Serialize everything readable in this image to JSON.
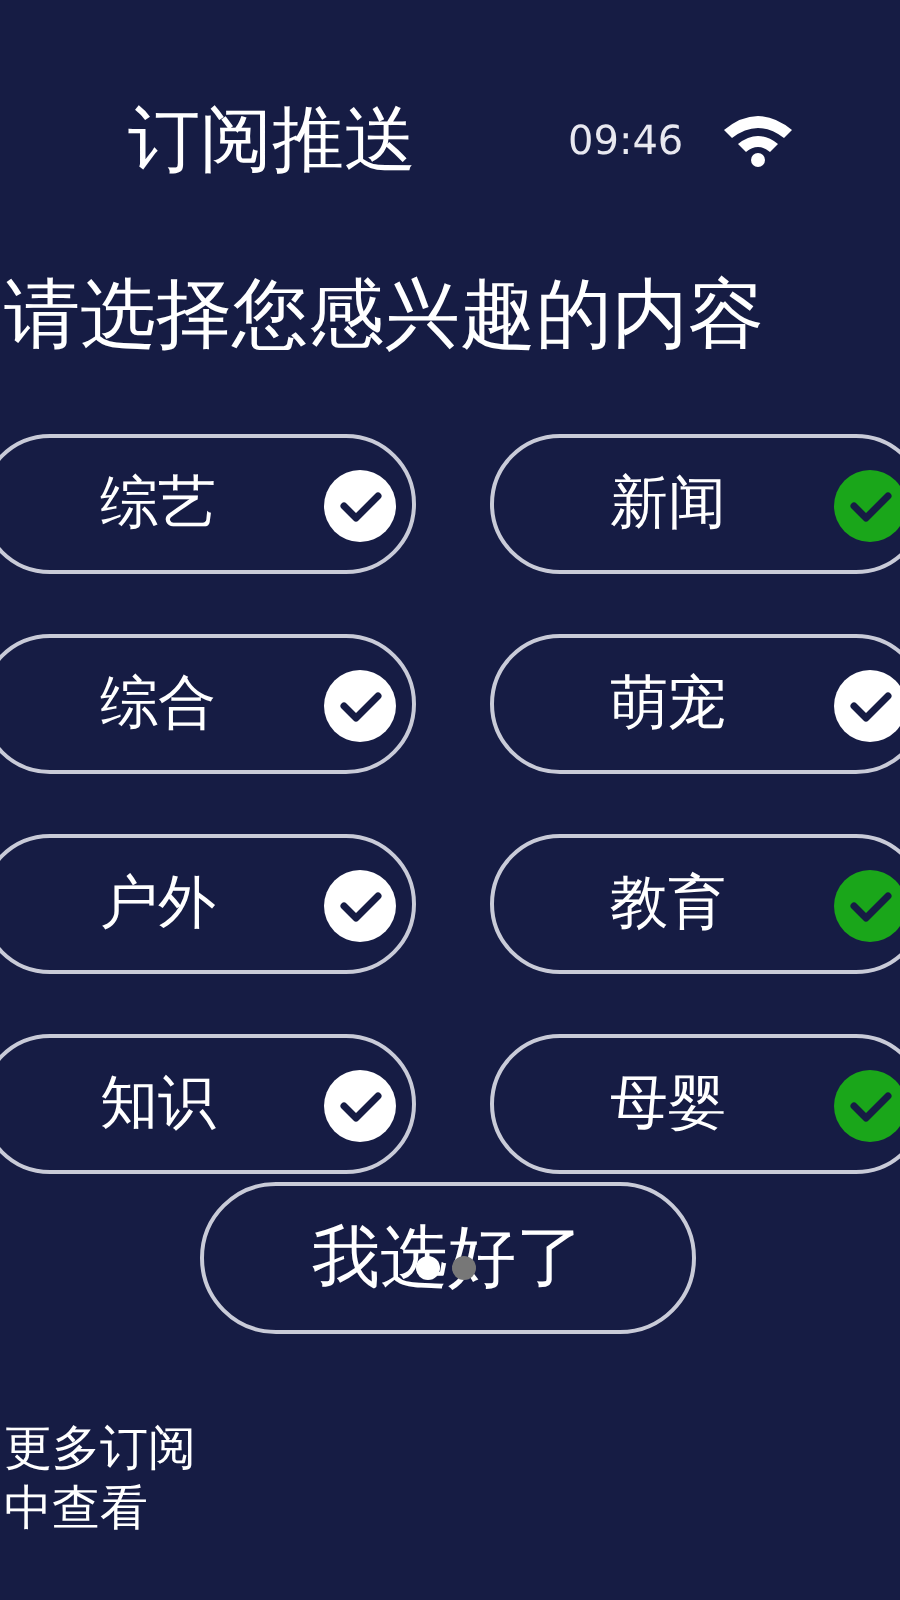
{
  "header": {
    "title": "订阅推送",
    "time": "09:46"
  },
  "prompt": "请选择您感兴趣的内容",
  "topics": [
    {
      "label": "综艺",
      "selected": false
    },
    {
      "label": "新闻",
      "selected": true
    },
    {
      "label": "综合",
      "selected": false
    },
    {
      "label": "萌宠",
      "selected": false
    },
    {
      "label": "户外",
      "selected": false
    },
    {
      "label": "教育",
      "selected": true
    },
    {
      "label": "知识",
      "selected": false
    },
    {
      "label": "母婴",
      "selected": true
    }
  ],
  "confirm_button": "我选好了",
  "pages": [
    {
      "selected": true
    },
    {
      "selected": false
    }
  ],
  "footer": [
    "更多订阅",
    "中查看"
  ]
}
